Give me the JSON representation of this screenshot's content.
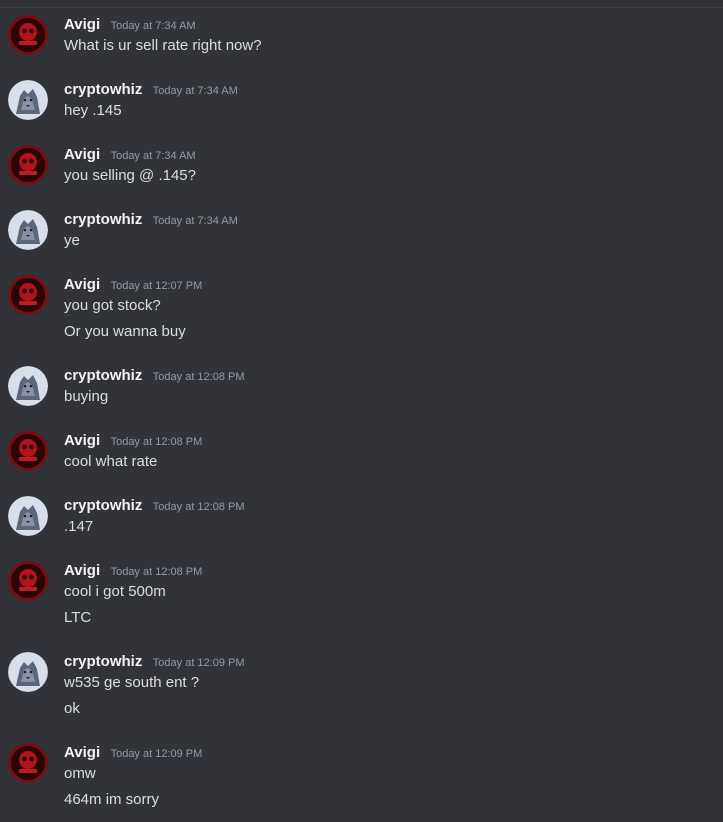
{
  "users": {
    "avigi": {
      "name": "Avigi",
      "avatar_icon": "red-skull-badge-icon",
      "color": "#a8161f"
    },
    "cryptowhiz": {
      "name": "cryptowhiz",
      "avatar_icon": "wolf-portrait-icon",
      "color": "#8aa0bf"
    }
  },
  "messages": [
    {
      "author": "avigi",
      "name": "Avigi",
      "time": "Today at 7:34 AM",
      "lines": [
        "What is ur sell rate right now?"
      ]
    },
    {
      "author": "cryptowhiz",
      "name": "cryptowhiz",
      "time": "Today at 7:34 AM",
      "lines": [
        "hey .145"
      ]
    },
    {
      "author": "avigi",
      "name": "Avigi",
      "time": "Today at 7:34 AM",
      "lines": [
        "you selling @ .145?"
      ]
    },
    {
      "author": "cryptowhiz",
      "name": "cryptowhiz",
      "time": "Today at 7:34 AM",
      "lines": [
        "ye"
      ]
    },
    {
      "author": "avigi",
      "name": "Avigi",
      "time": "Today at 12:07 PM",
      "lines": [
        "you got stock?",
        "Or you wanna buy"
      ]
    },
    {
      "author": "cryptowhiz",
      "name": "cryptowhiz",
      "time": "Today at 12:08 PM",
      "lines": [
        "buying"
      ]
    },
    {
      "author": "avigi",
      "name": "Avigi",
      "time": "Today at 12:08 PM",
      "lines": [
        "cool what rate"
      ]
    },
    {
      "author": "cryptowhiz",
      "name": "cryptowhiz",
      "time": "Today at 12:08 PM",
      "lines": [
        ".147"
      ]
    },
    {
      "author": "avigi",
      "name": "Avigi",
      "time": "Today at 12:08 PM",
      "lines": [
        "cool i got 500m",
        "LTC"
      ]
    },
    {
      "author": "cryptowhiz",
      "name": "cryptowhiz",
      "time": "Today at 12:09 PM",
      "lines": [
        "w535 ge south ent ?",
        "ok"
      ]
    },
    {
      "author": "avigi",
      "name": "Avigi",
      "time": "Today at 12:09 PM",
      "lines": [
        "omw",
        "464m im sorry"
      ]
    }
  ]
}
